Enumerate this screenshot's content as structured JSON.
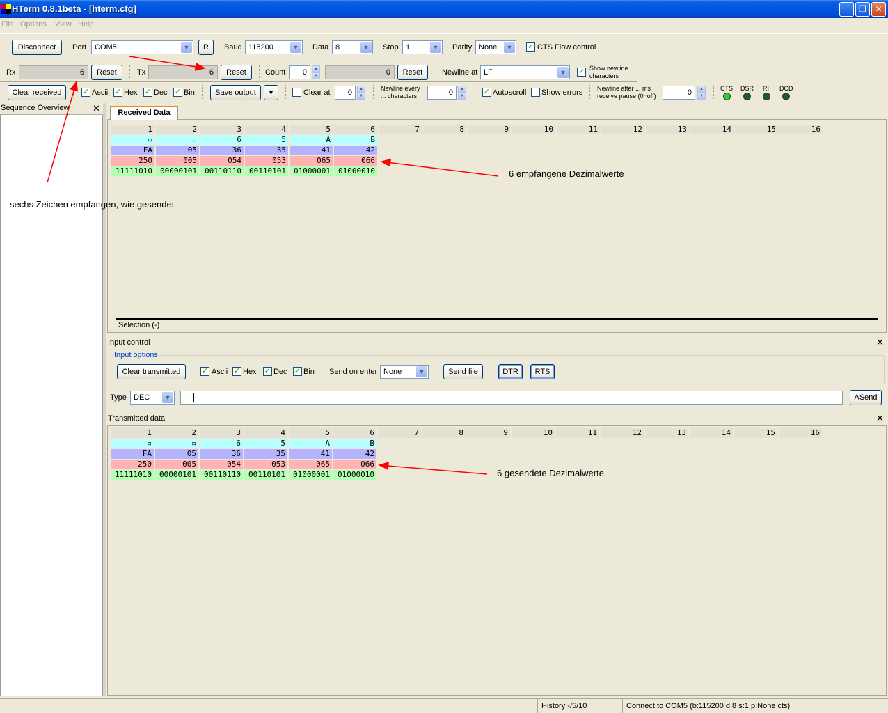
{
  "window": {
    "title": "HTerm 0.8.1beta - [hterm.cfg]",
    "minimize": "_",
    "restore": "❐",
    "close": "✕"
  },
  "menu": [
    "File",
    "Options",
    "View",
    "Help"
  ],
  "connection": {
    "disconnect_label": "Disconnect",
    "port_label": "Port",
    "port_value": "COM5",
    "r_label": "R",
    "baud_label": "Baud",
    "baud_value": "115200",
    "data_label": "Data",
    "data_value": "8",
    "stop_label": "Stop",
    "stop_value": "1",
    "parity_label": "Parity",
    "parity_value": "None",
    "cts_label": "CTS Flow control",
    "cts_checked": true
  },
  "counters": {
    "rx_label": "Rx",
    "rx_value": "6",
    "rx_reset": "Reset",
    "tx_label": "Tx",
    "tx_value": "6",
    "tx_reset": "Reset",
    "count_label": "Count",
    "count_value": "0",
    "count_display": "0",
    "count_reset": "Reset",
    "newline_at_label": "Newline at",
    "newline_at_value": "LF",
    "show_newline_label_1": "Show newline",
    "show_newline_label_2": "characters"
  },
  "receive_options": {
    "clear_received": "Clear received",
    "ascii": "Ascii",
    "hex": "Hex",
    "dec": "Dec",
    "bin": "Bin",
    "save_output": "Save output",
    "clear_at_label": "Clear at",
    "clear_at_value": "0",
    "newline_every_1": "Newline every",
    "newline_every_2": "... characters",
    "newline_every_value": "0",
    "autoscroll": "Autoscroll",
    "show_errors": "Show errors",
    "newline_after_1": "Newline after ... ms",
    "newline_after_2": "receive pause (0=off)",
    "newline_after_value": "0",
    "leds": [
      "CTS",
      "DSR",
      "RI",
      "DCD"
    ]
  },
  "sequence_overview": {
    "title": "Sequence Overview"
  },
  "received": {
    "tab": "Received Data",
    "columns": [
      "1",
      "2",
      "3",
      "4",
      "5",
      "6",
      "7",
      "8",
      "9",
      "10",
      "11",
      "12",
      "13",
      "14",
      "15",
      "16"
    ],
    "rows": {
      "ascii": [
        "▫",
        "▫",
        "6",
        "5",
        "A",
        "B"
      ],
      "hex": [
        "FA",
        "05",
        "36",
        "35",
        "41",
        "42"
      ],
      "dec": [
        "250",
        "005",
        "054",
        "053",
        "065",
        "066"
      ],
      "bin": [
        "11111010",
        "00000101",
        "00110110",
        "00110101",
        "01000001",
        "01000010"
      ]
    },
    "selection": "Selection (-)"
  },
  "input_control": {
    "title": "Input control",
    "options_title": "Input options",
    "clear_transmitted": "Clear transmitted",
    "ascii": "Ascii",
    "hex": "Hex",
    "dec": "Dec",
    "bin": "Bin",
    "send_on_enter_label": "Send on enter",
    "send_on_enter_value": "None",
    "send_file": "Send file",
    "dtr": "DTR",
    "rts": "RTS",
    "type_label": "Type",
    "type_value": "DEC",
    "input_value": "",
    "asend": "ASend"
  },
  "transmitted": {
    "title": "Transmitted data",
    "columns": [
      "1",
      "2",
      "3",
      "4",
      "5",
      "6",
      "7",
      "8",
      "9",
      "10",
      "11",
      "12",
      "13",
      "14",
      "15",
      "16"
    ],
    "rows": {
      "ascii": [
        "▫",
        "▫",
        "6",
        "5",
        "A",
        "B"
      ],
      "hex": [
        "FA",
        "05",
        "36",
        "35",
        "41",
        "42"
      ],
      "dec": [
        "250",
        "005",
        "054",
        "053",
        "065",
        "066"
      ],
      "bin": [
        "11111010",
        "00000101",
        "00110110",
        "00110101",
        "01000001",
        "01000010"
      ]
    }
  },
  "annotations": {
    "sent_chars": "sechs Zeichen empfangen, wie gesendet",
    "received_dec": "6 empfangene Dezimalwerte",
    "sent_dec": "6 gesendete Dezimalwerte",
    "arrow_color": "#ff0000"
  },
  "status": {
    "history": "History -/5/10",
    "connection": "Connect to COM5 (b:115200 d:8 s:1 p:None cts)"
  }
}
